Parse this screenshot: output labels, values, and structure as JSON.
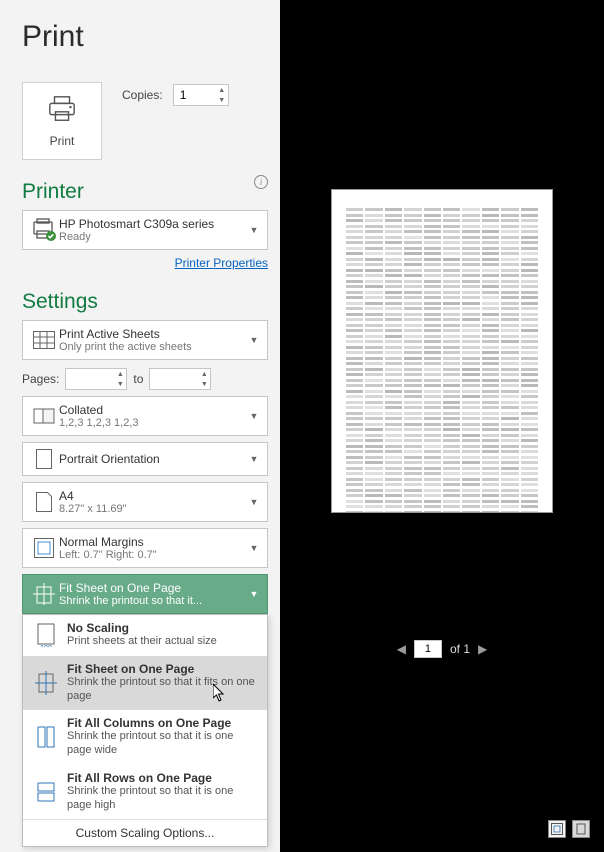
{
  "page_title": "Print",
  "print_button_label": "Print",
  "copies_label": "Copies:",
  "copies_value": "1",
  "printer_section": "Printer",
  "printer_name": "HP Photosmart C309a series",
  "printer_status": "Ready",
  "printer_properties": "Printer Properties",
  "settings_section": "Settings",
  "active_sheets": {
    "title": "Print Active Sheets",
    "sub": "Only print the active sheets"
  },
  "pages_label": "Pages:",
  "pages_to": "to",
  "pages_from": "",
  "pages_until": "",
  "collated": {
    "title": "Collated",
    "sub": "1,2,3    1,2,3    1,2,3"
  },
  "orientation": {
    "title": "Portrait Orientation"
  },
  "paper": {
    "title": "A4",
    "sub": "8.27\" x 11.69\""
  },
  "margins": {
    "title": "Normal Margins",
    "sub": "Left:  0.7\"    Right:  0.7\""
  },
  "scaling_selected": {
    "title": "Fit Sheet on One Page",
    "sub": "Shrink the printout so that it..."
  },
  "scaling_options": [
    {
      "title": "No Scaling",
      "sub": "Print sheets at their actual size"
    },
    {
      "title": "Fit Sheet on One Page",
      "sub": "Shrink the printout so that it fits on one page"
    },
    {
      "title": "Fit All Columns on One Page",
      "sub": "Shrink the printout so that it is one page wide"
    },
    {
      "title": "Fit All Rows on One Page",
      "sub": "Shrink the printout so that it is one page high"
    }
  ],
  "custom_scaling": "Custom Scaling Options...",
  "pager_current": "1",
  "pager_total": "of 1"
}
